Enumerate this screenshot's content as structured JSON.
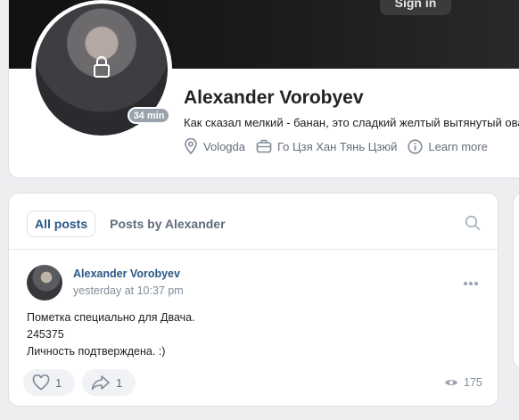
{
  "header": {
    "sign_in_label": "Sign in"
  },
  "profile": {
    "name": "Alexander Vorobyev",
    "status": "Как сказал мелкий - банан, это сладкий желтый вытянутый овал.",
    "online_badge": "34 min",
    "location": "Vologda",
    "work": "Го Цзя Хан Тянь Цзюй",
    "learn_more": "Learn more"
  },
  "posts": {
    "tabs": [
      "All posts",
      "Posts by Alexander"
    ],
    "post": {
      "author": "Alexander Vorobyev",
      "time": "yesterday at 10:37 pm",
      "lines": [
        "Пометка специально для Двача.",
        "245375",
        "Личность подтверждена. :)"
      ],
      "likes": "1",
      "shares": "1",
      "views": "175"
    }
  },
  "icons": {
    "lock": "lock-icon",
    "location": "location-pin-icon",
    "work": "briefcase-icon",
    "info": "info-icon",
    "search": "search-icon",
    "more": "more-horizontal-icon",
    "like": "heart-icon",
    "share": "share-icon",
    "views": "eye-icon"
  },
  "colors": {
    "link": "#2a5885",
    "secondary": "#626d7a",
    "background": "#edeef0",
    "card": "#ffffff"
  }
}
